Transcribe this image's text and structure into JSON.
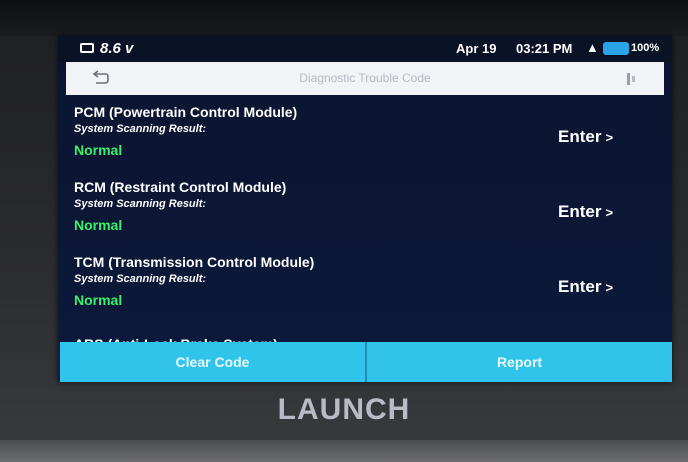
{
  "status": {
    "voltage": "8.6 v",
    "date": "Apr 19",
    "time": "03:21 PM",
    "battery_percent": "100%"
  },
  "titlebar": {
    "title": "Diagnostic Trouble Code"
  },
  "modules": [
    {
      "name": "PCM (Powertrain Control Module)",
      "sub": "System Scanning Result:",
      "result": "Normal",
      "enter": "Enter"
    },
    {
      "name": "RCM (Restraint Control Module)",
      "sub": "System Scanning Result:",
      "result": "Normal",
      "enter": "Enter"
    },
    {
      "name": "TCM (Transmission Control Module)",
      "sub": "System Scanning Result:",
      "result": "Normal",
      "enter": "Enter"
    }
  ],
  "partial_item": "ABS (Anti-Lock Brake System)",
  "buttons": {
    "clear_code": "Clear Code",
    "report": "Report"
  },
  "brand": "LAUNCH",
  "colors": {
    "accent": "#30c4ea",
    "normal": "#3bf06a",
    "screen_bg": "#0b1530"
  }
}
